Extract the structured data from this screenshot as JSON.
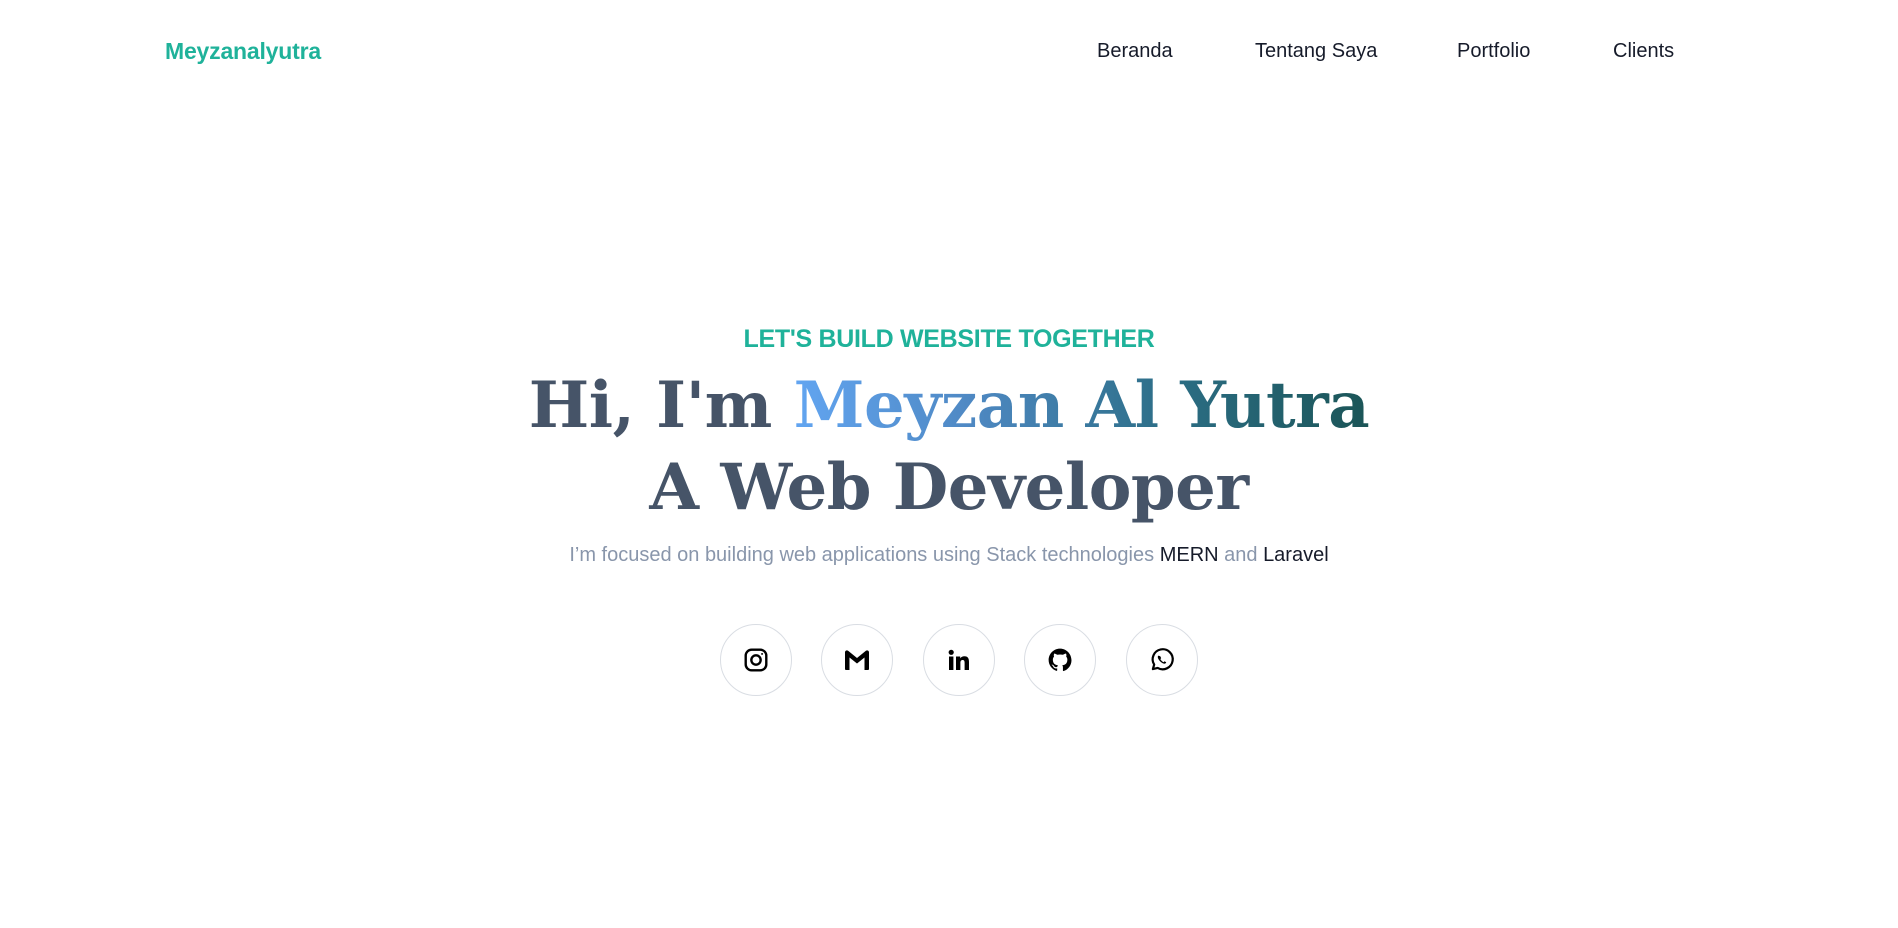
{
  "header": {
    "brand": "Meyzanalyutra",
    "nav": [
      {
        "label": "Beranda"
      },
      {
        "label": "Tentang Saya"
      },
      {
        "label": "Portfolio"
      },
      {
        "label": "Clients"
      }
    ]
  },
  "hero": {
    "eyebrow": "LET'S BUILD WEBSITE TOGETHER",
    "greeting": "Hi, I'm ",
    "name": "Meyzan Al Yutra",
    "role": "A Web Developer",
    "tagline_prefix": "I’m focused on building web applications using Stack technologies ",
    "tech_1": "MERN",
    "tagline_join": " and ",
    "tech_2": "Laravel"
  },
  "social": [
    {
      "icon": "instagram-icon"
    },
    {
      "icon": "gmail-icon"
    },
    {
      "icon": "linkedin-icon"
    },
    {
      "icon": "github-icon"
    },
    {
      "icon": "whatsapp-icon"
    }
  ],
  "colors": {
    "accent": "#1fb29a",
    "heading": "#465468",
    "muted": "#8996ab",
    "text": "#161b2a",
    "gradient_start": "#62a5f1",
    "gradient_end": "#1b5557"
  }
}
